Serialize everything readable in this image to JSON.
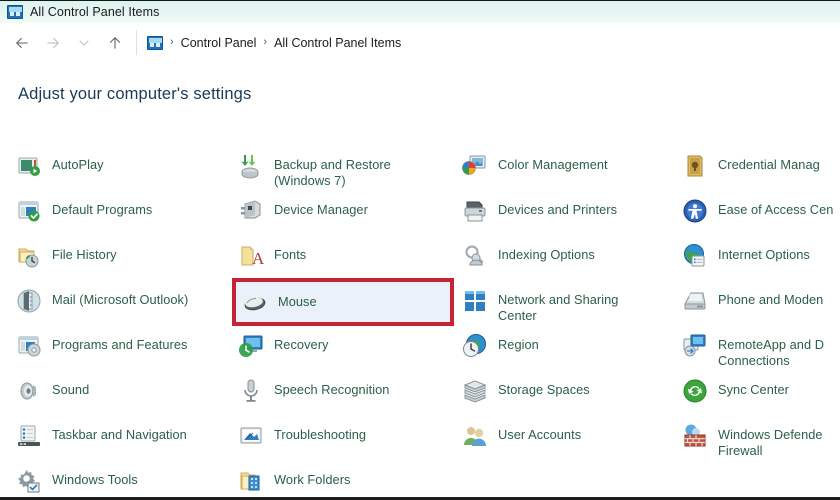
{
  "window": {
    "title": "All Control Panel Items",
    "title_icon": "control-panel-icon"
  },
  "nav": {
    "back_icon": "arrow-left-icon",
    "forward_icon": "arrow-right-icon",
    "recent_icon": "chevron-down-icon",
    "up_icon": "arrow-up-icon",
    "breadcrumb_icon": "control-panel-icon",
    "breadcrumb": [
      {
        "label": "Control Panel"
      },
      {
        "label": "All Control Panel Items"
      }
    ],
    "separator": "›"
  },
  "heading": "Adjust your computer's settings",
  "highlight": {
    "target": "Mouse",
    "border_color": "#c42434",
    "fill_color": "#eaf1fa"
  },
  "colors": {
    "titlebar": "#e4f5f1",
    "heading_text": "#1b3a57",
    "item_text": "#2b6046",
    "accent_red": "#c42434",
    "selection_blue": "#eaf1fa"
  },
  "columns": [
    {
      "items": [
        {
          "label": "AutoPlay",
          "icon": "autoplay-icon"
        },
        {
          "label": "Default Programs",
          "icon": "default-programs-icon"
        },
        {
          "label": "File History",
          "icon": "file-history-icon"
        },
        {
          "label": "Mail (Microsoft Outlook)",
          "icon": "mail-icon"
        },
        {
          "label": "Programs and Features",
          "icon": "programs-and-features-icon"
        },
        {
          "label": "Sound",
          "icon": "sound-icon"
        },
        {
          "label": "Taskbar and Navigation",
          "icon": "taskbar-and-navigation-icon"
        },
        {
          "label": "Windows Tools",
          "icon": "windows-tools-icon"
        }
      ]
    },
    {
      "items": [
        {
          "label": "Backup and Restore\n(Windows 7)",
          "icon": "backup-and-restore-icon"
        },
        {
          "label": "Device Manager",
          "icon": "device-manager-icon"
        },
        {
          "label": "Fonts",
          "icon": "fonts-icon"
        },
        {
          "label": "Mouse",
          "icon": "mouse-icon"
        },
        {
          "label": "Recovery",
          "icon": "recovery-icon"
        },
        {
          "label": "Speech Recognition",
          "icon": "speech-recognition-icon"
        },
        {
          "label": "Troubleshooting",
          "icon": "troubleshooting-icon"
        },
        {
          "label": "Work Folders",
          "icon": "work-folders-icon"
        }
      ]
    },
    {
      "items": [
        {
          "label": "Color Management",
          "icon": "color-management-icon"
        },
        {
          "label": "Devices and Printers",
          "icon": "devices-and-printers-icon"
        },
        {
          "label": "Indexing Options",
          "icon": "indexing-options-icon"
        },
        {
          "label": "Network and Sharing\nCenter",
          "icon": "network-and-sharing-center-icon"
        },
        {
          "label": "Region",
          "icon": "region-icon"
        },
        {
          "label": "Storage Spaces",
          "icon": "storage-spaces-icon"
        },
        {
          "label": "User Accounts",
          "icon": "user-accounts-icon"
        }
      ]
    },
    {
      "items": [
        {
          "label": "Credential Manag",
          "icon": "credential-manager-icon"
        },
        {
          "label": "Ease of Access Cen",
          "icon": "ease-of-access-center-icon"
        },
        {
          "label": "Internet Options",
          "icon": "internet-options-icon"
        },
        {
          "label": "Phone and Moden",
          "icon": "phone-and-modem-icon"
        },
        {
          "label": "RemoteApp and D\nConnections",
          "icon": "remoteapp-connections-icon"
        },
        {
          "label": "Sync Center",
          "icon": "sync-center-icon"
        },
        {
          "label": "Windows Defende\nFirewall",
          "icon": "windows-defender-firewall-icon"
        }
      ]
    }
  ]
}
